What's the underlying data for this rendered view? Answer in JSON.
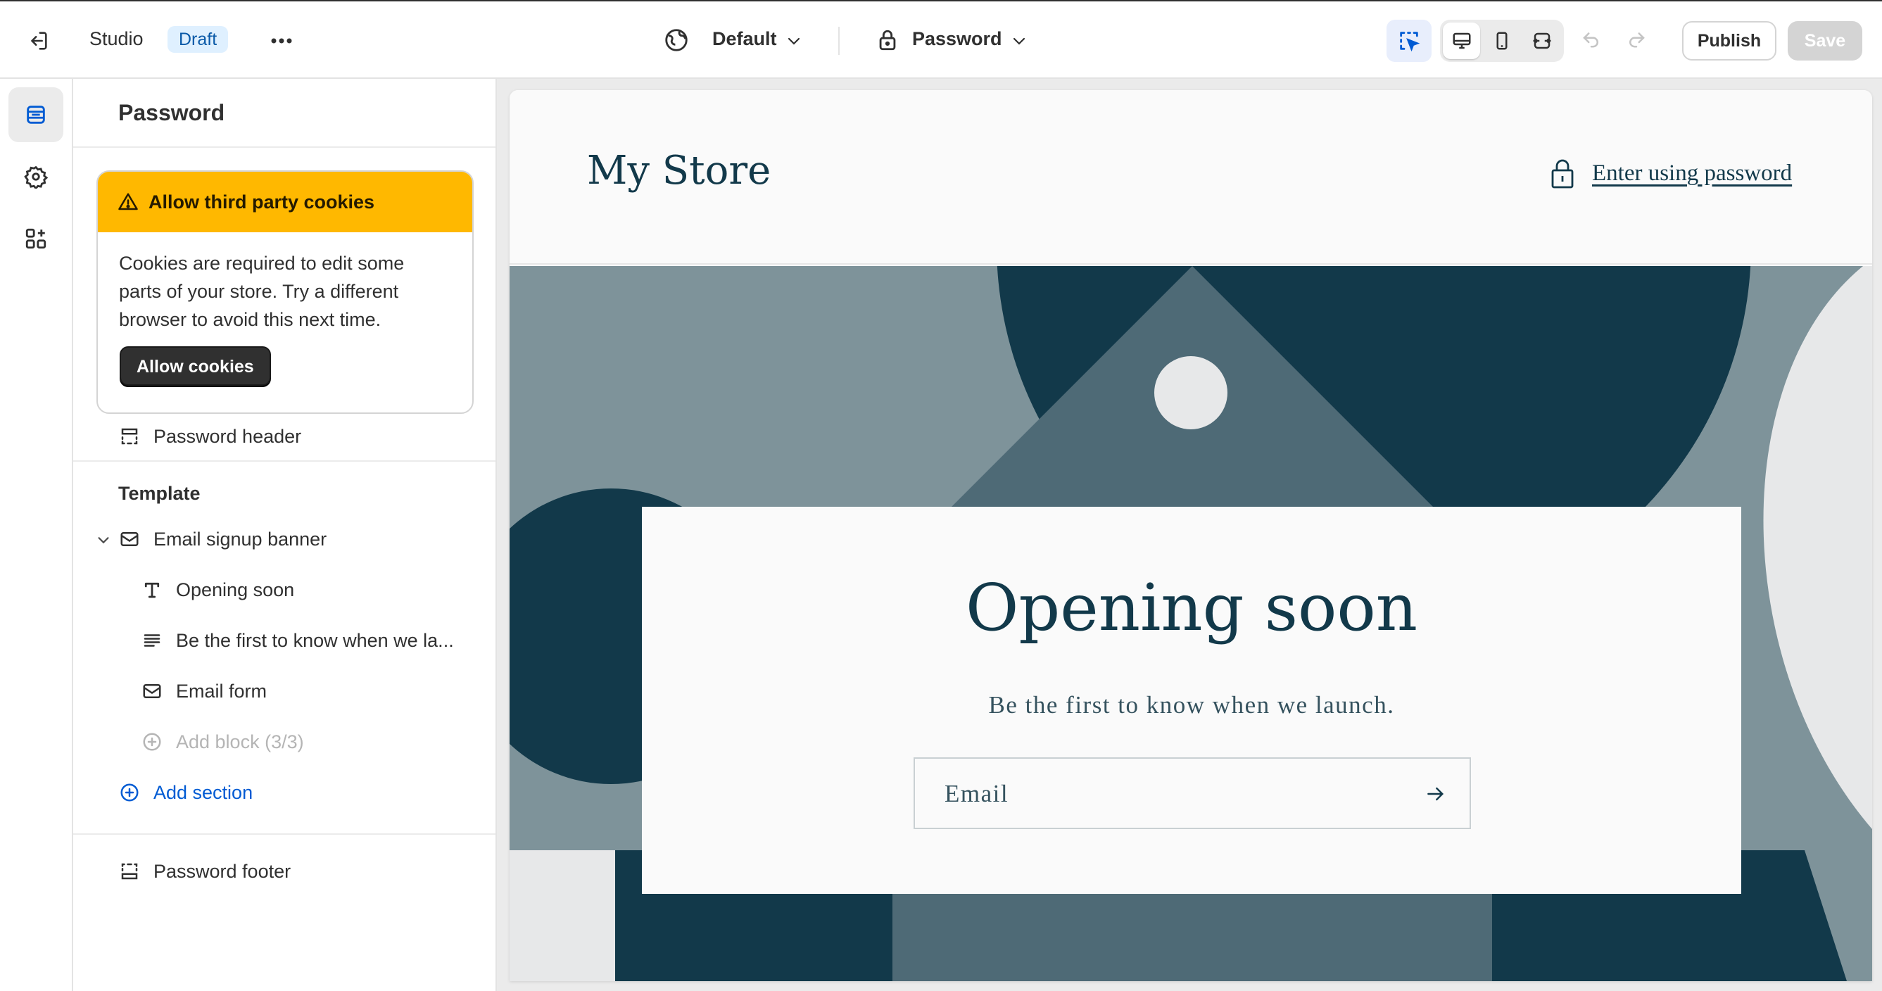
{
  "topbar": {
    "app_name": "Studio",
    "status_badge": "Draft",
    "theme_selector": "Default",
    "page_selector": "Password",
    "publish_label": "Publish",
    "save_label": "Save",
    "icons": [
      "exit-icon",
      "more-icon",
      "globe-icon",
      "chevron-down-icon",
      "lock-icon",
      "inspector-icon",
      "desktop-icon",
      "mobile-icon",
      "fullwidth-icon",
      "undo-icon",
      "redo-icon"
    ]
  },
  "rail": {
    "items": [
      {
        "name": "sections",
        "icon": "sections-icon",
        "active": true
      },
      {
        "name": "settings",
        "icon": "gear-icon",
        "active": false
      },
      {
        "name": "apps",
        "icon": "apps-icon",
        "active": false
      }
    ]
  },
  "sidebar": {
    "title": "Password",
    "cookie_banner": {
      "title": "Allow third party cookies",
      "body": "Cookies are required to edit some parts of your store. Try a different browser to avoid this next time.",
      "button": "Allow cookies"
    },
    "header_section": "Password header",
    "template_label": "Template",
    "section": "Email signup banner",
    "blocks": [
      "Opening soon",
      "Be the first to know when we la...",
      "Email form"
    ],
    "add_block": "Add block (3/3)",
    "add_section": "Add section",
    "footer_section": "Password footer"
  },
  "preview": {
    "store_name": "My Store",
    "enter_password": "Enter using password",
    "heading": "Opening soon",
    "subheading": "Be the first to know when we launch.",
    "email_placeholder": "Email",
    "colors": {
      "dark": "#12394a",
      "mid": "#4e6a76",
      "light": "#7e939a",
      "pale": "#e7e8e9"
    }
  },
  "colors": {
    "accent": "#005bd3",
    "warning": "#ffb800",
    "draft_badge_bg": "#dff0ff"
  }
}
